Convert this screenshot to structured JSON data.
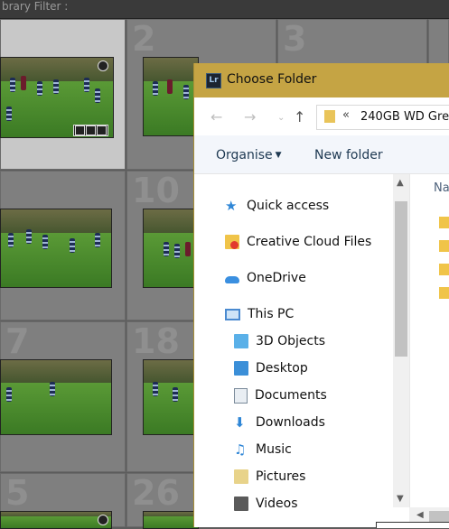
{
  "library": {
    "filter_label": "brary Filter :",
    "cells": [
      {
        "num": "",
        "selected": true
      },
      {
        "num": "2",
        "selected": false
      },
      {
        "num": "3",
        "selected": false
      },
      {
        "num": "",
        "selected": false
      },
      {
        "num": "",
        "selected": false
      },
      {
        "num": "10",
        "selected": false
      },
      {
        "num": "",
        "selected": false
      },
      {
        "num": "7",
        "selected": false
      },
      {
        "num": "18",
        "selected": false
      },
      {
        "num": "5",
        "selected": false
      },
      {
        "num": "26",
        "selected": false
      }
    ]
  },
  "dialog": {
    "app_icon": "Lr",
    "title": "Choose Folder",
    "address": {
      "separator": "«",
      "path": "240GB WD Gre"
    },
    "toolbar": {
      "organise": "Organise",
      "new_folder": "New folder"
    },
    "nav": {
      "quick_access": "Quick access",
      "creative_cloud": "Creative Cloud Files",
      "onedrive": "OneDrive",
      "this_pc": "This PC",
      "items": [
        "3D Objects",
        "Desktop",
        "Documents",
        "Downloads",
        "Music",
        "Pictures",
        "Videos"
      ]
    },
    "content": {
      "name_header": "Na"
    }
  },
  "colors": {
    "title_bar": "#c5a444",
    "lightroom_bg": "#7f7f7f",
    "selected_cell": "#c8c8c8",
    "folder": "#f0c449",
    "link_blue": "#2f86d6"
  }
}
